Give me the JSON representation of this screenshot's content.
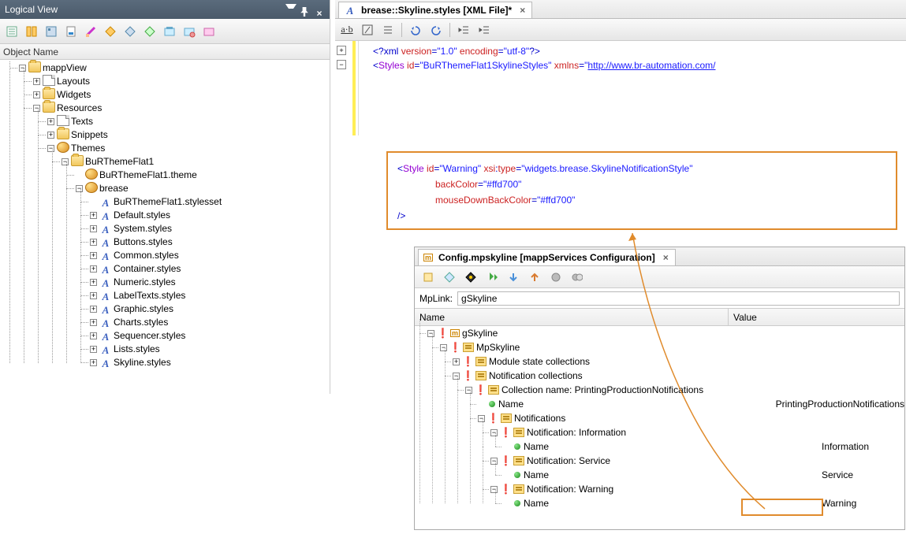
{
  "leftPanel": {
    "title": "Logical View",
    "columnHeader": "Object Name",
    "tree": {
      "root": "mappView",
      "layouts": "Layouts",
      "widgets": "Widgets",
      "resources": "Resources",
      "texts": "Texts",
      "snippets": "Snippets",
      "themes": "Themes",
      "themeFolder": "BuRThemeFlat1",
      "themeFile": "BuRThemeFlat1.theme",
      "brease": "brease",
      "stylesset": "BuRThemeFlat1.stylesset",
      "styles": [
        "Default.styles",
        "System.styles",
        "Buttons.styles",
        "Common.styles",
        "Container.styles",
        "Numeric.styles",
        "LabelTexts.styles",
        "Graphic.styles",
        "Charts.styles",
        "Sequencer.styles",
        "Lists.styles",
        "Skyline.styles"
      ]
    }
  },
  "editor": {
    "tabTitle": "brease::Skyline.styles [XML File]*",
    "lines": {
      "l1a": "<?",
      "l1b": "xml ",
      "l1c": "version",
      "l1d": "=",
      "l1e": "\"1.0\"",
      "l1f": " encoding",
      "l1g": "=",
      "l1h": "\"utf-8\"",
      "l1i": "?>",
      "l2a": "<",
      "l2b": "Styles ",
      "l2c": "id",
      "l2d": "=",
      "l2e": "\"BuRThemeFlat1SkylineStyles\"",
      "l2f": " xmlns",
      "l2g": "=",
      "l2h": "\"",
      "l2link": "http://www.br-automation.com/"
    }
  },
  "xmlBox": {
    "l1a": "<",
    "l1b": "Style ",
    "l1c": "id",
    "l1d": "=",
    "l1e": "\"Warning\"",
    "l1f": " xsi",
    "l1g": ":",
    "l1h": "type",
    "l1i": "=",
    "l1j": "\"widgets.brease.SkylineNotificationStyle\"",
    "l2a": "backColor",
    "l2b": "=",
    "l2c": "\"#ffd700\"",
    "l3a": "mouseDownBackColor",
    "l3b": "=",
    "l3c": "\"#ffd700\"",
    "l4": "/>"
  },
  "cfg": {
    "tabTitle": "Config.mpskyline [mappServices Configuration]",
    "mpLinkLabel": "MpLink:",
    "mpLinkValue": "gSkyline",
    "head": {
      "name": "Name",
      "value": "Value"
    },
    "rows": {
      "root": "gSkyline",
      "mpskyline": "MpSkyline",
      "msc": "Module state collections",
      "nc": "Notification collections",
      "collName": "Collection name: PrintingProductionNotifications",
      "nameLbl": "Name",
      "val1": "PrintingProductionNotifications",
      "notifications": "Notifications",
      "notifInfo": "Notification: Information",
      "valInfo": "Information",
      "notifSvc": "Notification: Service",
      "valSvc": "Service",
      "notifWarn": "Notification: Warning",
      "valWarn": "Warning"
    }
  }
}
